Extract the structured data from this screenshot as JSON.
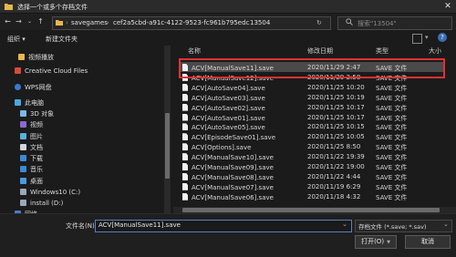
{
  "window": {
    "title": "选择一个或多个存档文件"
  },
  "nav": {
    "breadcrumb": [
      "savegames",
      "cef2a5cbd-a91c-4122-9523-fc961b795edc",
      "13504"
    ],
    "search_placeholder": "搜索\"13504\""
  },
  "toolbar": {
    "organize": "组织 ▾",
    "new_folder": "新建文件夹"
  },
  "sidebar": {
    "items": [
      {
        "label": "视频播放",
        "icon": "folder-icon"
      },
      {
        "label": "Creative Cloud Files",
        "icon": "cloud-icon"
      },
      {
        "label": "WPS网盘",
        "icon": "cloud-icon"
      },
      {
        "label": "此电脑",
        "icon": "computer-icon"
      },
      {
        "label": "3D 对象",
        "icon": "cube-icon"
      },
      {
        "label": "视频",
        "icon": "video-icon"
      },
      {
        "label": "图片",
        "icon": "picture-icon"
      },
      {
        "label": "文档",
        "icon": "document-icon"
      },
      {
        "label": "下载",
        "icon": "download-icon"
      },
      {
        "label": "音乐",
        "icon": "music-icon"
      },
      {
        "label": "桌面",
        "icon": "desktop-icon"
      },
      {
        "label": "Windows10 (C:)",
        "icon": "drive-icon"
      },
      {
        "label": "install (D:)",
        "icon": "drive-icon"
      },
      {
        "label": "网络",
        "icon": "network-icon"
      }
    ]
  },
  "list": {
    "headers": {
      "name": "名称",
      "modified": "修改日期",
      "type": "类型",
      "size": "大小"
    },
    "rows": [
      {
        "name": "ACV[ManualSave11].save",
        "date": "2020/11/29 2:47",
        "type": "SAVE 文件"
      },
      {
        "name": "ACV[ManualSave12].save",
        "date": "2020/11/29 2:58",
        "type": "SAVE 文件"
      },
      {
        "name": "ACV[AutoSave04].save",
        "date": "2020/11/25 10:20",
        "type": "SAVE 文件"
      },
      {
        "name": "ACV[AutoSave03].save",
        "date": "2020/11/25 10:19",
        "type": "SAVE 文件"
      },
      {
        "name": "ACV[AutoSave02].save",
        "date": "2020/11/25 10:17",
        "type": "SAVE 文件"
      },
      {
        "name": "ACV[AutoSave01].save",
        "date": "2020/11/25 10:17",
        "type": "SAVE 文件"
      },
      {
        "name": "ACV[AutoSave05].save",
        "date": "2020/11/25 10:15",
        "type": "SAVE 文件"
      },
      {
        "name": "ACV[EpisodeSave01].save",
        "date": "2020/11/25 10:05",
        "type": "SAVE 文件"
      },
      {
        "name": "ACV[Options].save",
        "date": "2020/11/25 8:50",
        "type": "SAVE 文件"
      },
      {
        "name": "ACV[ManualSave10].save",
        "date": "2020/11/22 19:39",
        "type": "SAVE 文件"
      },
      {
        "name": "ACV[ManualSave09].save",
        "date": "2020/11/22 19:00",
        "type": "SAVE 文件"
      },
      {
        "name": "ACV[ManualSave08].save",
        "date": "2020/11/22 4:44",
        "type": "SAVE 文件"
      },
      {
        "name": "ACV[ManualSave07].save",
        "date": "2020/11/19 6:29",
        "type": "SAVE 文件"
      },
      {
        "name": "ACV[ManualSave06].save",
        "date": "2020/11/18 4:32",
        "type": "SAVE 文件"
      }
    ]
  },
  "footer": {
    "filename_label": "文件名(N):",
    "filename_value": "ACV[ManualSave11].save",
    "filetype_value": "存档文件 (*.save; *.sav)",
    "open_label": "打开(O)",
    "cancel_label": "取消"
  },
  "colors": {
    "selection": "#4a4a4a",
    "highlight": "#e23131",
    "background": "#1b1b1b"
  }
}
